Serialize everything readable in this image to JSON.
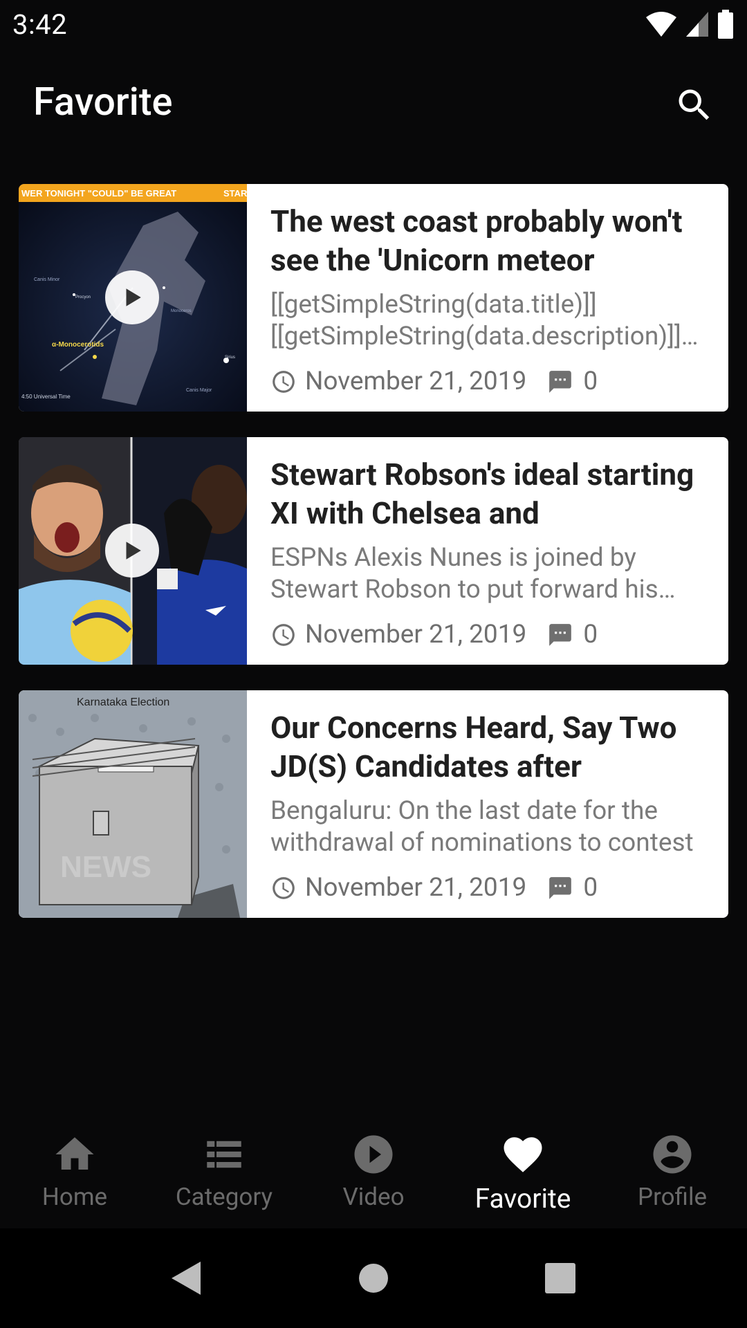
{
  "status_bar": {
    "time": "3:42"
  },
  "app_bar": {
    "title": "Favorite"
  },
  "articles": [
    {
      "title": "The west coast probably won't see the 'Unicorn meteor",
      "description": "[[getSimpleString(data.title)]] [[getSimpleString(data.description)]] [[getSimpleString(data.title)]]",
      "date": "November 21, 2019",
      "comments": "0",
      "thumb_banner": "WER TONIGHT \"COULD\" BE GREAT",
      "thumb_banner_right": "STAR",
      "thumb_labels": [
        "α-Monocerotids",
        "4:50 Universal Time",
        "Canis Minor",
        "Procyon",
        "Monoceros",
        "Sirius",
        "Canis Major"
      ],
      "is_video": true
    },
    {
      "title": "Stewart Robson's ideal starting XI with Chelsea and",
      "description": "ESPNs Alexis Nunes is joined by Stewart Robson to put forward his ideal starting XI",
      "date": "November 21, 2019",
      "comments": "0",
      "is_video": true
    },
    {
      "title": "Our Concerns Heard, Say Two JD(S) Candidates after",
      "description": "Bengaluru: On the last date for the withdrawal of nominations to contest",
      "date": "November 21, 2019",
      "comments": "0",
      "thumb_caption": "Karnataka Election",
      "thumb_watermark": "NEWS",
      "is_video": false
    }
  ],
  "bottom_nav": {
    "items": [
      {
        "label": "Home",
        "icon": "home-icon"
      },
      {
        "label": "Category",
        "icon": "list-icon"
      },
      {
        "label": "Video",
        "icon": "play-circle-icon"
      },
      {
        "label": "Favorite",
        "icon": "heart-icon",
        "active": true
      },
      {
        "label": "Profile",
        "icon": "account-circle-icon"
      }
    ]
  },
  "colors": {
    "background": "#080809",
    "card": "#ffffff",
    "nav_inactive": "#6b6b6b",
    "nav_active": "#ffffff"
  }
}
